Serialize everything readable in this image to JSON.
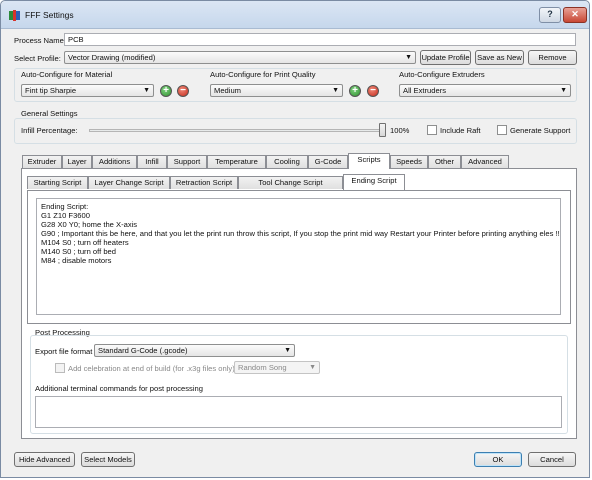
{
  "window": {
    "title": "FFF Settings",
    "help_label": "?",
    "close_label": "✕"
  },
  "process": {
    "label": "Process Name:",
    "value": "PCB"
  },
  "profile": {
    "label": "Select Profile:",
    "value": "Vector Drawing (modified)",
    "update_label": "Update Profile",
    "save_as_label": "Save as New",
    "remove_label": "Remove"
  },
  "auto_material": {
    "label": "Auto-Configure for Material",
    "value": "Fint tip Sharpie"
  },
  "auto_quality": {
    "label": "Auto-Configure for Print Quality",
    "value": "Medium"
  },
  "auto_extruders": {
    "label": "Auto-Configure Extruders",
    "value": "All Extruders"
  },
  "general": {
    "label": "General Settings",
    "infill_label": "Infill Percentage:",
    "infill_value": "100%",
    "infill_fraction": 1.0,
    "include_raft_label": "Include Raft",
    "generate_support_label": "Generate Support"
  },
  "main_tabs": [
    "Extruder",
    "Layer",
    "Additions",
    "Infill",
    "Support",
    "Temperature",
    "Cooling",
    "G-Code",
    "Scripts",
    "Speeds",
    "Other",
    "Advanced"
  ],
  "script_tabs": [
    "Starting Script",
    "Layer Change Script",
    "Retraction Script",
    "Tool Change Script",
    "Ending Script"
  ],
  "ending_script": {
    "lines": [
      "Ending Script:",
      "G1 Z10 F3600",
      "G28 X0 Y0; home the X-axis",
      "G90  ; Important this be here, and that you let the print run throw this script,  If you stop the print mid way Restart your Printer before printing anything eles !!",
      "M104 S0 ; turn off heaters",
      "M140 S0 ; turn off bed",
      "M84 ; disable motors"
    ]
  },
  "post_processing": {
    "label": "Post Processing",
    "export_label": "Export file format",
    "export_value": "Standard G-Code (.gcode)",
    "celebration_label": "Add celebration at end of build (for .x3g files only)",
    "song_value": "Random Song",
    "terminal_label": "Additional terminal commands for post processing",
    "terminal_value": ""
  },
  "footer": {
    "hide_advanced_label": "Hide Advanced",
    "select_models_label": "Select Models",
    "ok_label": "OK",
    "cancel_label": "Cancel"
  },
  "icons": {
    "dropdown": "chevron-down-icon",
    "add": "plus-icon",
    "remove": "minus-icon",
    "app": "app-icon"
  }
}
